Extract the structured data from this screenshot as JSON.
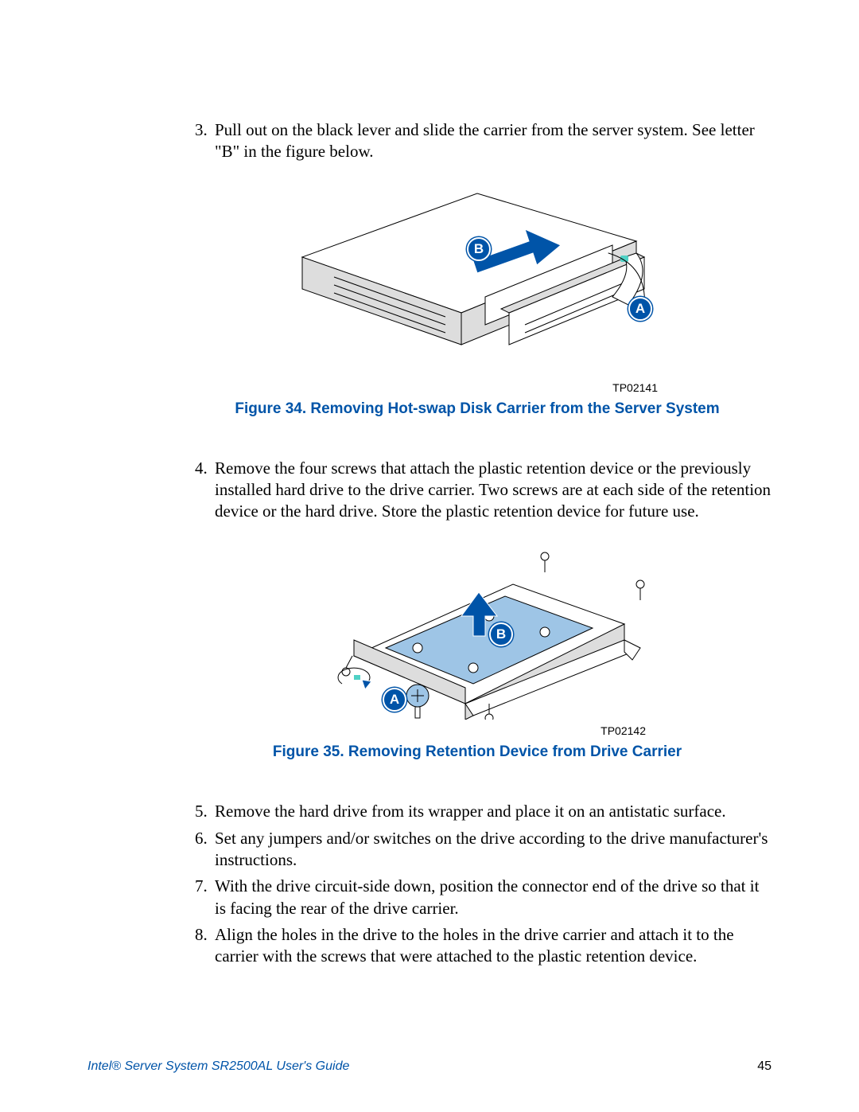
{
  "steps": {
    "s3": "Pull out on the black lever and slide the carrier from the server system. See letter \"B\" in the figure below.",
    "s4": "Remove the four screws that attach the plastic retention device or the previously installed hard drive to the drive carrier. Two screws are at each side of the retention device or the hard drive. Store the plastic retention device for future use.",
    "s5": "Remove the hard drive from its wrapper and place it on an antistatic surface.",
    "s6": "Set any jumpers and/or switches on the drive according to the drive manufacturer's instructions.",
    "s7": "With the drive circuit-side down, position the connector end of the drive so that it is facing the rear of the drive carrier.",
    "s8": "Align the holes in the drive to the holes in the drive carrier and attach it to the carrier with the screws that were attached to the plastic retention device."
  },
  "figures": {
    "f34": {
      "id": "TP02141",
      "caption": "Figure 34. Removing Hot-swap Disk Carrier from the Server System",
      "callout_a": "A",
      "callout_b": "B"
    },
    "f35": {
      "id": "TP02142",
      "caption": "Figure 35. Removing Retention Device from Drive Carrier",
      "callout_a": "A",
      "callout_b": "B"
    }
  },
  "footer": {
    "title": "Intel® Server System SR2500AL User's Guide",
    "page": "45"
  }
}
